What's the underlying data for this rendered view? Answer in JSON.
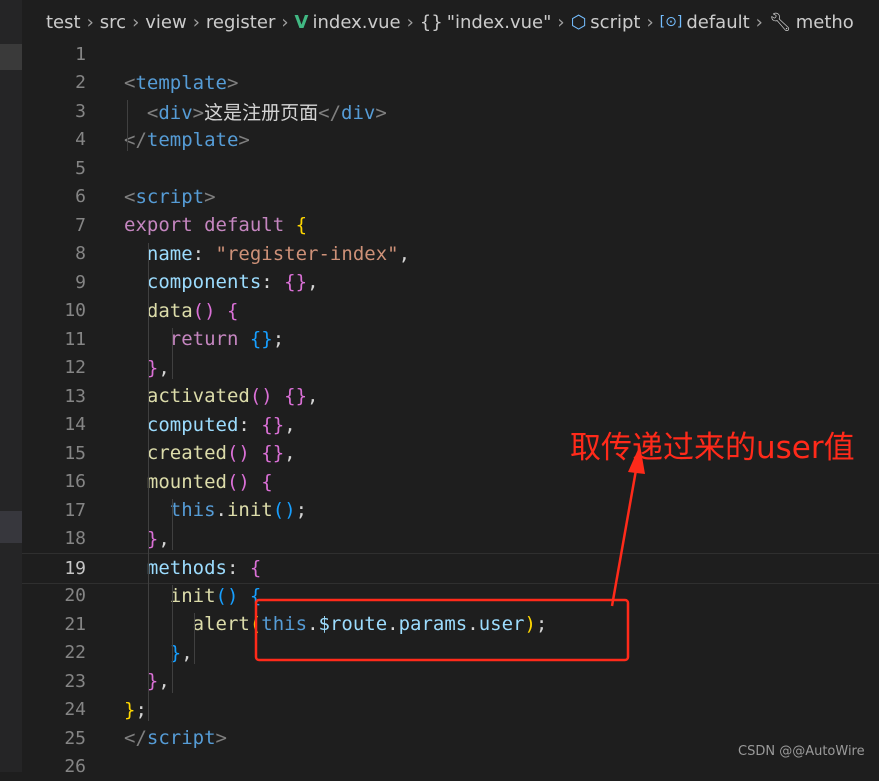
{
  "breadcrumb": {
    "items": [
      "test",
      "src",
      "view",
      "register",
      "index.vue",
      "\"index.vue\"",
      "script",
      "default",
      "metho"
    ]
  },
  "lines": [
    {
      "n": "1",
      "tokens": []
    },
    {
      "n": "2",
      "tokens": [
        {
          "t": "<",
          "c": "br"
        },
        {
          "t": "template",
          "c": "tag"
        },
        {
          "t": ">",
          "c": "br"
        }
      ]
    },
    {
      "n": "3",
      "tokens": [
        {
          "t": "  ",
          "c": "txt"
        },
        {
          "t": "<",
          "c": "br"
        },
        {
          "t": "div",
          "c": "tag"
        },
        {
          "t": ">",
          "c": "br"
        },
        {
          "t": "这是注册页面",
          "c": "txt"
        },
        {
          "t": "</",
          "c": "br"
        },
        {
          "t": "div",
          "c": "tag"
        },
        {
          "t": ">",
          "c": "br"
        }
      ]
    },
    {
      "n": "4",
      "tokens": [
        {
          "t": "</",
          "c": "br"
        },
        {
          "t": "template",
          "c": "tag"
        },
        {
          "t": ">",
          "c": "br"
        }
      ]
    },
    {
      "n": "5",
      "tokens": []
    },
    {
      "n": "6",
      "tokens": [
        {
          "t": "<",
          "c": "br"
        },
        {
          "t": "script",
          "c": "tag"
        },
        {
          "t": ">",
          "c": "br"
        }
      ]
    },
    {
      "n": "7",
      "tokens": [
        {
          "t": "export default ",
          "c": "kw"
        },
        {
          "t": "{",
          "c": "b1"
        }
      ]
    },
    {
      "n": "8",
      "tokens": [
        {
          "t": "  ",
          "c": "txt"
        },
        {
          "t": "name",
          "c": "prop"
        },
        {
          "t": ": ",
          "c": "txt"
        },
        {
          "t": "\"register-index\"",
          "c": "str"
        },
        {
          "t": ",",
          "c": "txt"
        }
      ]
    },
    {
      "n": "9",
      "tokens": [
        {
          "t": "  ",
          "c": "txt"
        },
        {
          "t": "components",
          "c": "prop"
        },
        {
          "t": ": ",
          "c": "txt"
        },
        {
          "t": "{}",
          "c": "b2"
        },
        {
          "t": ",",
          "c": "txt"
        }
      ]
    },
    {
      "n": "10",
      "tokens": [
        {
          "t": "  ",
          "c": "txt"
        },
        {
          "t": "data",
          "c": "fn"
        },
        {
          "t": "() ",
          "c": "b2"
        },
        {
          "t": "{",
          "c": "b2"
        }
      ]
    },
    {
      "n": "11",
      "tokens": [
        {
          "t": "    ",
          "c": "txt"
        },
        {
          "t": "return ",
          "c": "kw"
        },
        {
          "t": "{}",
          "c": "b3"
        },
        {
          "t": ";",
          "c": "txt"
        }
      ]
    },
    {
      "n": "12",
      "tokens": [
        {
          "t": "  ",
          "c": "txt"
        },
        {
          "t": "}",
          "c": "b2"
        },
        {
          "t": ",",
          "c": "txt"
        }
      ]
    },
    {
      "n": "13",
      "tokens": [
        {
          "t": "  ",
          "c": "txt"
        },
        {
          "t": "activated",
          "c": "fn"
        },
        {
          "t": "() {}",
          "c": "b2"
        },
        {
          "t": ",",
          "c": "txt"
        }
      ]
    },
    {
      "n": "14",
      "tokens": [
        {
          "t": "  ",
          "c": "txt"
        },
        {
          "t": "computed",
          "c": "prop"
        },
        {
          "t": ": ",
          "c": "txt"
        },
        {
          "t": "{}",
          "c": "b2"
        },
        {
          "t": ",",
          "c": "txt"
        }
      ]
    },
    {
      "n": "15",
      "tokens": [
        {
          "t": "  ",
          "c": "txt"
        },
        {
          "t": "created",
          "c": "fn"
        },
        {
          "t": "() {}",
          "c": "b2"
        },
        {
          "t": ",",
          "c": "txt"
        }
      ]
    },
    {
      "n": "16",
      "tokens": [
        {
          "t": "  ",
          "c": "txt"
        },
        {
          "t": "mounted",
          "c": "fn"
        },
        {
          "t": "() ",
          "c": "b2"
        },
        {
          "t": "{",
          "c": "b2"
        }
      ]
    },
    {
      "n": "17",
      "tokens": [
        {
          "t": "    ",
          "c": "txt"
        },
        {
          "t": "this",
          "c": "thiskw"
        },
        {
          "t": ".",
          "c": "txt"
        },
        {
          "t": "init",
          "c": "fn"
        },
        {
          "t": "()",
          "c": "b3"
        },
        {
          "t": ";",
          "c": "txt"
        }
      ]
    },
    {
      "n": "18",
      "tokens": [
        {
          "t": "  ",
          "c": "txt"
        },
        {
          "t": "}",
          "c": "b2"
        },
        {
          "t": ",",
          "c": "txt"
        }
      ]
    },
    {
      "n": "19",
      "tokens": [
        {
          "t": "  ",
          "c": "txt"
        },
        {
          "t": "methods",
          "c": "prop"
        },
        {
          "t": ": ",
          "c": "txt"
        },
        {
          "t": "{",
          "c": "b2"
        }
      ]
    },
    {
      "n": "20",
      "tokens": [
        {
          "t": "    ",
          "c": "txt"
        },
        {
          "t": "init",
          "c": "fn"
        },
        {
          "t": "() ",
          "c": "b3"
        },
        {
          "t": "{",
          "c": "b3"
        }
      ]
    },
    {
      "n": "21",
      "tokens": [
        {
          "t": "      ",
          "c": "txt"
        },
        {
          "t": "alert",
          "c": "fn"
        },
        {
          "t": "(",
          "c": "b1"
        },
        {
          "t": "this",
          "c": "thiskw"
        },
        {
          "t": ".",
          "c": "txt"
        },
        {
          "t": "$route",
          "c": "prop"
        },
        {
          "t": ".",
          "c": "txt"
        },
        {
          "t": "params",
          "c": "prop"
        },
        {
          "t": ".",
          "c": "txt"
        },
        {
          "t": "user",
          "c": "prop"
        },
        {
          "t": ")",
          "c": "b1"
        },
        {
          "t": ";",
          "c": "txt"
        }
      ]
    },
    {
      "n": "22",
      "tokens": [
        {
          "t": "    ",
          "c": "txt"
        },
        {
          "t": "}",
          "c": "b3"
        },
        {
          "t": ",",
          "c": "txt"
        }
      ]
    },
    {
      "n": "23",
      "tokens": [
        {
          "t": "  ",
          "c": "txt"
        },
        {
          "t": "}",
          "c": "b2"
        },
        {
          "t": ",",
          "c": "txt"
        }
      ]
    },
    {
      "n": "24",
      "tokens": [
        {
          "t": "}",
          "c": "b1"
        },
        {
          "t": ";",
          "c": "txt"
        }
      ]
    },
    {
      "n": "25",
      "tokens": [
        {
          "t": "</",
          "c": "br"
        },
        {
          "t": "script",
          "c": "tag"
        },
        {
          "t": ">",
          "c": "br"
        }
      ]
    },
    {
      "n": "26",
      "tokens": []
    }
  ],
  "current_line": "19",
  "annotation": {
    "text": "取传递过来的user值",
    "color": "#ff2a1a"
  },
  "watermark": "CSDN @@AutoWire"
}
